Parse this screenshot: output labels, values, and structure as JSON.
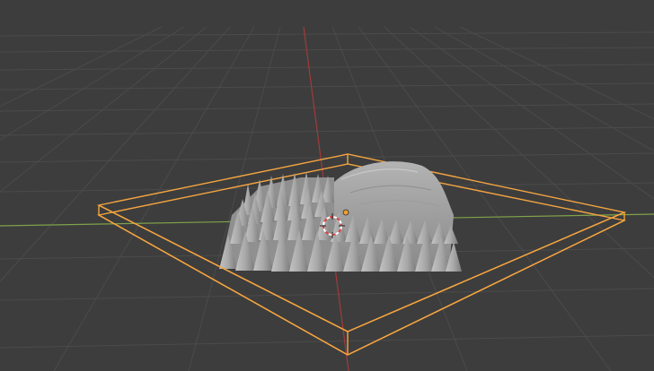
{
  "viewport": {
    "mode": "3d-viewport",
    "background_color": "#3d3d3d",
    "grid_color": "#4a4a4a",
    "x_axis_color": "#80a34a",
    "y_axis_color": "#a33a3a",
    "selection_color": "#f5a540",
    "mesh_color": "#9a9a9a",
    "cursor_colors": [
      "#e04040",
      "#ffffff"
    ],
    "origin_color": "#f0a030"
  },
  "scene": {
    "selected_object": "terrain-mesh",
    "objects": [
      {
        "id": "terrain-mesh",
        "icon": "mesh-icon",
        "selected": true
      }
    ],
    "gizmos": [
      "3d-cursor",
      "object-origin",
      "bounding-box"
    ]
  }
}
